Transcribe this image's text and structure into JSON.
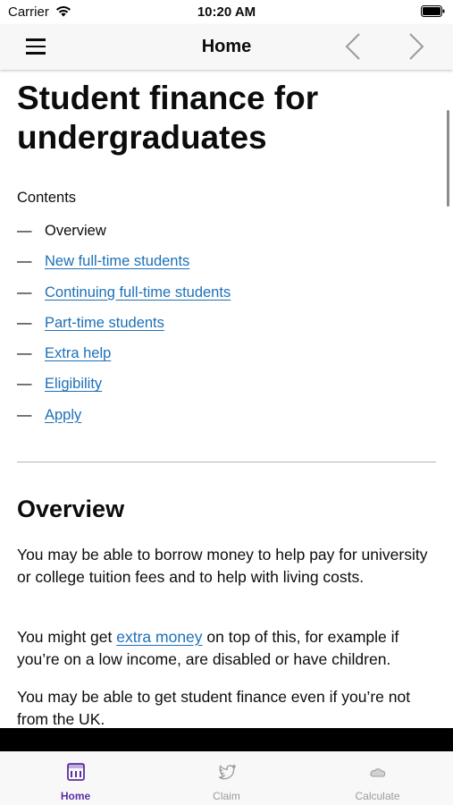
{
  "status_bar": {
    "carrier": "Carrier",
    "time": "10:20 AM"
  },
  "nav": {
    "title": "Home",
    "icons": [
      "menu-icon",
      "back-chevron-icon",
      "forward-chevron-icon"
    ]
  },
  "page": {
    "title": "Student finance for undergraduates",
    "contents_label": "Contents",
    "toc": [
      {
        "label": "Overview",
        "link": false
      },
      {
        "label": "New full-time students",
        "link": true
      },
      {
        "label": "Continuing full-time students",
        "link": true
      },
      {
        "label": "Part-time students",
        "link": true
      },
      {
        "label": "Extra help",
        "link": true
      },
      {
        "label": "Eligibility",
        "link": true
      },
      {
        "label": "Apply",
        "link": true
      }
    ],
    "dash": "—",
    "section_title": "Overview",
    "p1": "You may be able to borrow money to help pay for university or college tuition fees and to help with living costs.",
    "p2_before": "You might get ",
    "p2_link": "extra money",
    "p2_after": " on top of this, for example if you’re on a low income, are disabled or have children.",
    "p3": "You may be able to get student finance even if you’re not from the UK."
  },
  "tabs": [
    {
      "label": "Home",
      "icon": "home-icon",
      "active": true
    },
    {
      "label": "Claim",
      "icon": "bird-icon",
      "active": false
    },
    {
      "label": "Calculate",
      "icon": "cloud-icon",
      "active": false
    }
  ],
  "colors": {
    "link": "#1d70b8",
    "active_tab": "#5a2ea6",
    "inactive_tab": "#9b9b9b"
  }
}
